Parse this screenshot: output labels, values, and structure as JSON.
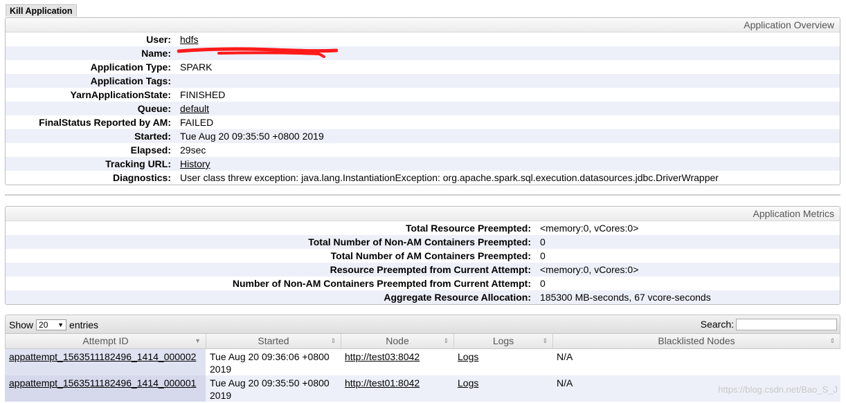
{
  "kill_button": "Kill Application",
  "overview": {
    "title": "Application Overview",
    "rows": [
      {
        "label": "User:",
        "value": "hdfs"
      },
      {
        "label": "Name:",
        "value": ""
      },
      {
        "label": "Application Type:",
        "value": "SPARK"
      },
      {
        "label": "Application Tags:",
        "value": ""
      },
      {
        "label": "YarnApplicationState:",
        "value": "FINISHED"
      },
      {
        "label": "Queue:",
        "value": "default"
      },
      {
        "label": "FinalStatus Reported by AM:",
        "value": "FAILED"
      },
      {
        "label": "Started:",
        "value": "Tue Aug 20 09:35:50 +0800 2019"
      },
      {
        "label": "Elapsed:",
        "value": "29sec"
      },
      {
        "label": "Tracking URL:",
        "value": "History"
      },
      {
        "label": "Diagnostics:",
        "value": "User class threw exception: java.lang.InstantiationException: org.apache.spark.sql.execution.datasources.jdbc.DriverWrapper"
      }
    ]
  },
  "metrics": {
    "title": "Application Metrics",
    "rows": [
      {
        "label": "Total Resource Preempted:",
        "value": "<memory:0, vCores:0>"
      },
      {
        "label": "Total Number of Non-AM Containers Preempted:",
        "value": "0"
      },
      {
        "label": "Total Number of AM Containers Preempted:",
        "value": "0"
      },
      {
        "label": "Resource Preempted from Current Attempt:",
        "value": "<memory:0, vCores:0>"
      },
      {
        "label": "Number of Non-AM Containers Preempted from Current Attempt:",
        "value": "0"
      },
      {
        "label": "Aggregate Resource Allocation:",
        "value": "185300 MB-seconds, 67 vcore-seconds"
      }
    ]
  },
  "attempts": {
    "show_label": "Show",
    "page_size": "20",
    "entries_label": "entries",
    "search_label": "Search:",
    "columns": [
      "Attempt ID",
      "Started",
      "Node",
      "Logs",
      "Blacklisted Nodes"
    ],
    "rows": [
      {
        "attempt_id": "appattempt_1563511182496_1414_000002",
        "started": "Tue Aug 20 09:36:06 +0800 2019",
        "node": "http://test03:8042",
        "logs": "Logs",
        "blacklisted": "N/A"
      },
      {
        "attempt_id": "appattempt_1563511182496_1414_000001",
        "started": "Tue Aug 20 09:35:50 +0800 2019",
        "node": "http://test01:8042",
        "logs": "Logs",
        "blacklisted": "N/A"
      }
    ]
  },
  "watermark": "https://blog.csdn.net/Bao_S_J",
  "colors": {
    "redaction": "#ff1a1a",
    "alt_row": "#eef0f9"
  }
}
